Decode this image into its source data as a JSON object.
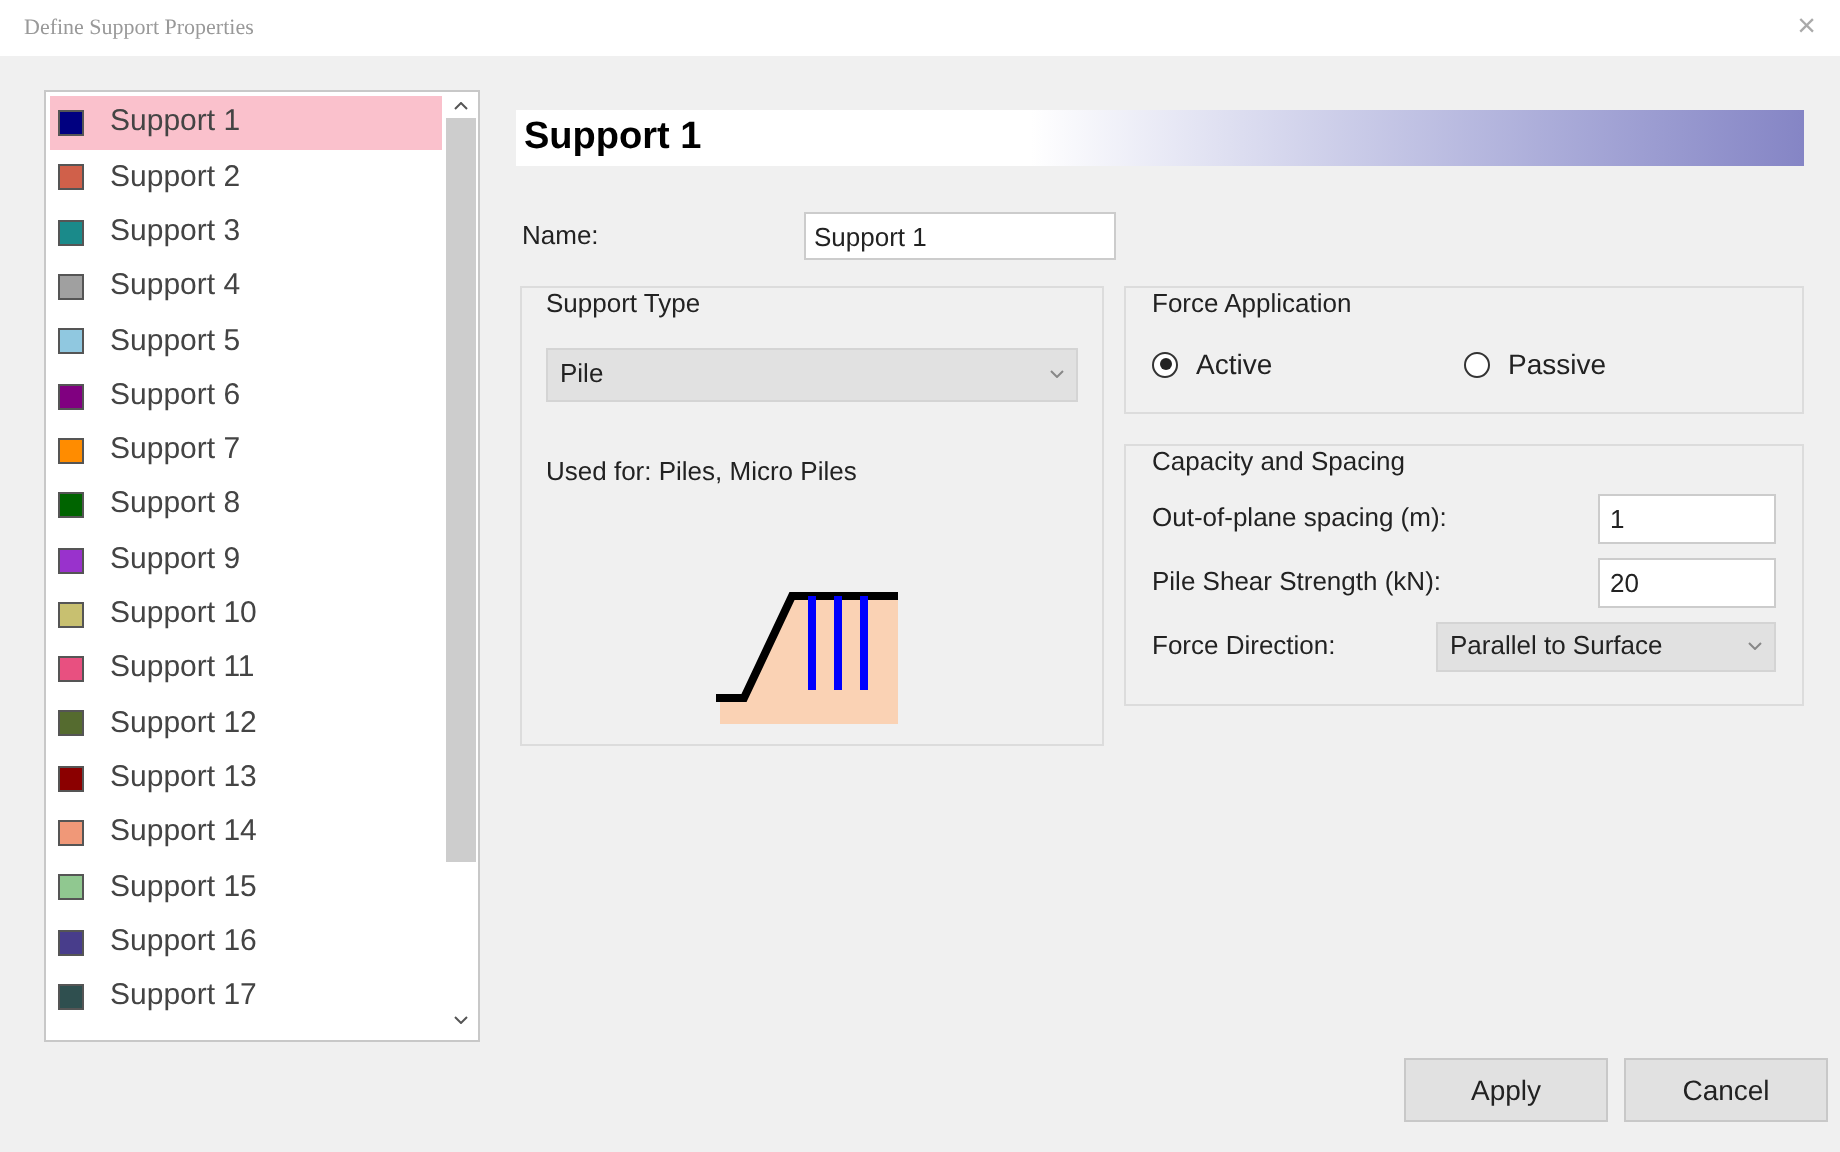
{
  "window": {
    "title": "Define Support Properties",
    "close": "×"
  },
  "supports": [
    {
      "label": "Support 1",
      "color": "#000080",
      "selected": true
    },
    {
      "label": "Support 2",
      "color": "#d0604a",
      "selected": false
    },
    {
      "label": "Support 3",
      "color": "#1a8a8a",
      "selected": false
    },
    {
      "label": "Support 4",
      "color": "#a0a0a0",
      "selected": false
    },
    {
      "label": "Support 5",
      "color": "#90c8e0",
      "selected": false
    },
    {
      "label": "Support 6",
      "color": "#800080",
      "selected": false
    },
    {
      "label": "Support 7",
      "color": "#ff8c00",
      "selected": false
    },
    {
      "label": "Support 8",
      "color": "#006400",
      "selected": false
    },
    {
      "label": "Support 9",
      "color": "#9932cc",
      "selected": false
    },
    {
      "label": "Support 10",
      "color": "#c8c070",
      "selected": false
    },
    {
      "label": "Support 11",
      "color": "#e85080",
      "selected": false
    },
    {
      "label": "Support 12",
      "color": "#556b2f",
      "selected": false
    },
    {
      "label": "Support 13",
      "color": "#8b0000",
      "selected": false
    },
    {
      "label": "Support 14",
      "color": "#f09878",
      "selected": false
    },
    {
      "label": "Support 15",
      "color": "#90c890",
      "selected": false
    },
    {
      "label": "Support 16",
      "color": "#483d8b",
      "selected": false
    },
    {
      "label": "Support 17",
      "color": "#2f4f4f",
      "selected": false
    }
  ],
  "header": "Support 1",
  "name": {
    "label": "Name:",
    "value": "Support 1"
  },
  "support_type": {
    "title": "Support Type",
    "value": "Pile",
    "used_for": "Used for: Piles, Micro Piles"
  },
  "force_application": {
    "title": "Force Application",
    "options": [
      {
        "label": "Active",
        "selected": true
      },
      {
        "label": "Passive",
        "selected": false
      }
    ]
  },
  "capacity": {
    "title": "Capacity and Spacing",
    "fields": [
      {
        "kind": "input",
        "label": "Out-of-plane spacing (m):",
        "value": "1"
      },
      {
        "kind": "input",
        "label": "Pile Shear Strength (kN):",
        "value": "20"
      },
      {
        "kind": "dropdown",
        "label": "Force Direction:",
        "value": "Parallel to Surface"
      }
    ]
  },
  "buttons": [
    "Apply",
    "Cancel"
  ]
}
